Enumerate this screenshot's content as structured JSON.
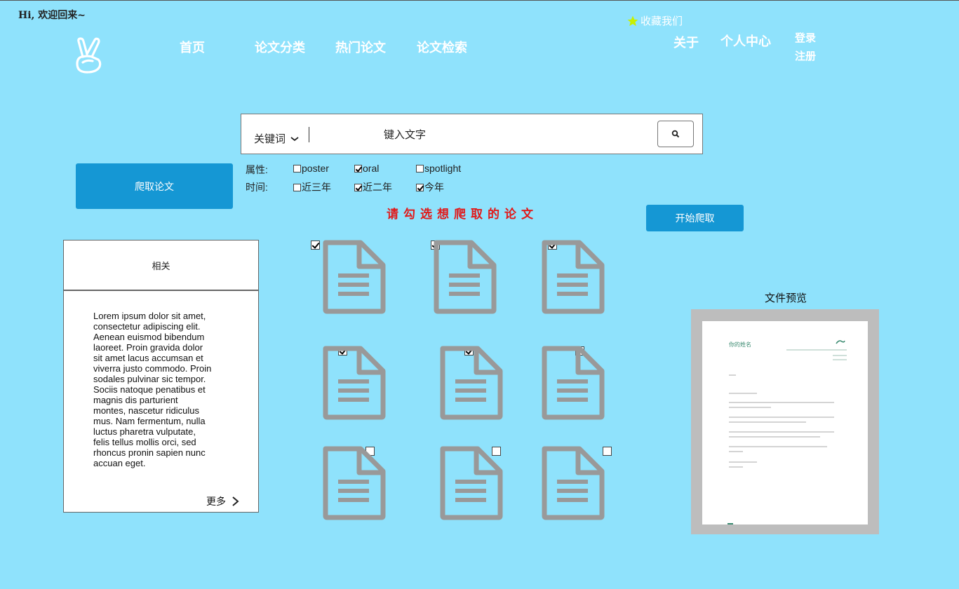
{
  "header": {
    "greeting": "Hi, 欢迎回来~",
    "nav": [
      "首页",
      "论文分类",
      "热门论文",
      "论文检索"
    ],
    "favorite": "收藏我们",
    "about": "关于",
    "personal_center": "个人中心",
    "login": "登录",
    "register": "注册"
  },
  "search": {
    "keyword_selector": "关键词",
    "placeholder": "键入文字"
  },
  "crawl_button": "爬取论文",
  "filters": {
    "attribute_label": "属性:",
    "attributes": [
      {
        "label": "poster",
        "checked": false
      },
      {
        "label": "oral",
        "checked": true
      },
      {
        "label": "spotlight",
        "checked": false
      }
    ],
    "time_label": "时间:",
    "times": [
      {
        "label": "近三年",
        "checked": false
      },
      {
        "label": "近二年",
        "checked": true
      },
      {
        "label": "今年",
        "checked": true
      }
    ]
  },
  "hint": "请勾选想爬取的论文",
  "start_button": "开始爬取",
  "related": {
    "title": "相关",
    "body": "Lorem ipsum dolor sit amet, consectetur adipiscing elit. Aenean euismod bibendum laoreet. Proin gravida dolor sit amet lacus accumsan et viverra justo commodo. Proin sodales pulvinar sic tempor. Sociis natoque penatibus et magnis dis parturient montes, nascetur ridiculus mus. Nam fermentum, nulla luctus pharetra vulputate, felis tellus mollis orci, sed rhoncus pronin sapien nunc accuan eget.",
    "more": "更多"
  },
  "documents": [
    {
      "checked": true
    },
    {
      "checked": true
    },
    {
      "checked": true
    },
    {
      "checked": true
    },
    {
      "checked": true
    },
    {
      "checked": false
    },
    {
      "checked": false
    },
    {
      "checked": false
    },
    {
      "checked": false
    }
  ],
  "preview": {
    "title": "文件预览",
    "doc_name": "你的姓名"
  },
  "colors": {
    "background": "#8fe2fc",
    "button": "#1597d4",
    "hint": "#e11a1a",
    "doc_icon": "#999999",
    "star": "#c8f000"
  }
}
